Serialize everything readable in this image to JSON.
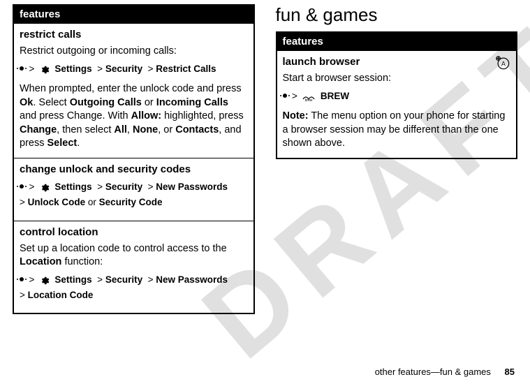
{
  "left": {
    "header": "features",
    "rows": [
      {
        "title": "restrict calls",
        "body1": "Restrict outgoing or incoming calls:",
        "path_parts": {
          "s": "Settings",
          "sec": "Security",
          "rc": "Restrict Calls"
        },
        "body2_pre": "When prompted, enter the unlock code and press ",
        "ok": "Ok",
        "body2_mid1": ". Select ",
        "out": "Outgoing Calls",
        "or": " or ",
        "inc": "Incoming Calls",
        "body2_mid2": " and press Change. With ",
        "allow": "Allow:",
        "body2_mid3": " highlighted, press ",
        "change": "Change",
        "body2_mid4": ", then select ",
        "all": "All",
        "c1": ", ",
        "none": "None",
        "c2": ", or ",
        "contacts": "Contacts",
        "body2_mid5": ", and press ",
        "select": "Select",
        "body2_end": "."
      },
      {
        "title": "change unlock and security codes",
        "path_parts": {
          "s": "Settings",
          "sec": "Security",
          "np": "New Passwords",
          "uc": "Unlock Code",
          "or": " or ",
          "sc": "Security Code"
        }
      },
      {
        "title": "control location",
        "body1": "Set up a location code to control access to the ",
        "loc": "Location",
        "body1b": " function:",
        "path_parts": {
          "s": "Settings",
          "sec": "Security",
          "np": "New Passwords",
          "lc": "Location Code"
        }
      }
    ]
  },
  "right": {
    "heading": "fun & games",
    "header": "features",
    "row": {
      "title": "launch browser",
      "body1": "Start a browser session:",
      "brew": "BREW",
      "note_lbl": "Note:",
      "note": " The menu option on your phone for starting a browser session may be different than the one shown above."
    }
  },
  "footer": {
    "text": "other features—fun & games",
    "page": "85"
  },
  "watermark": "DRAFT"
}
